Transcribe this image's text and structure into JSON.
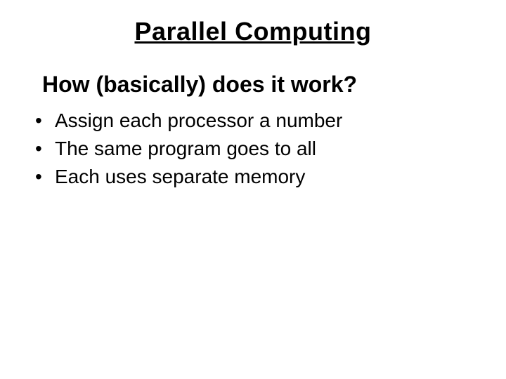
{
  "title": "Parallel Computing",
  "subtitle": "How (basically) does it work?",
  "bullets": [
    "Assign each processor a number",
    "The same program goes to all",
    "Each uses separate memory"
  ]
}
